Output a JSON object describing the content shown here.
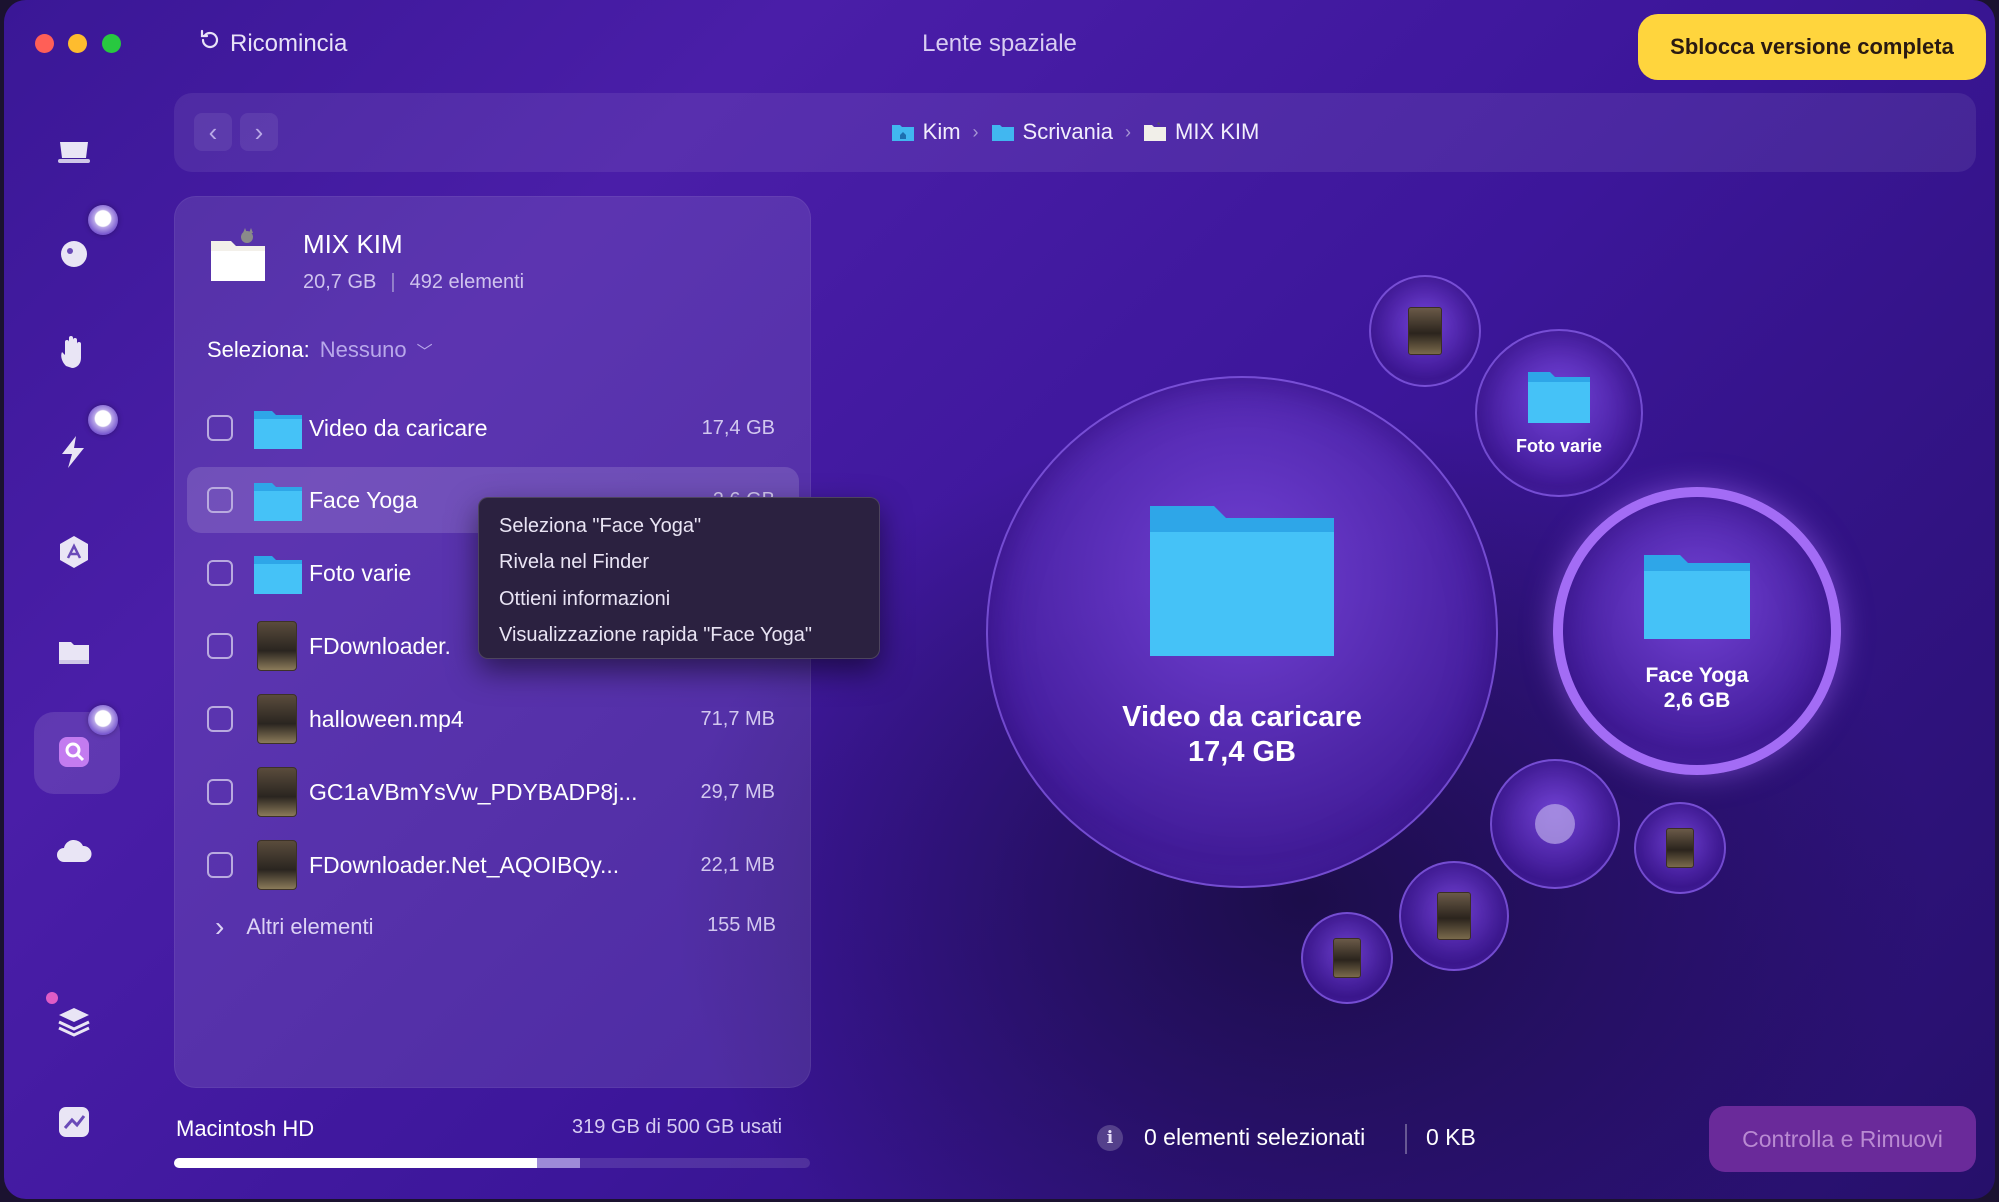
{
  "window": {
    "title": "Lente spaziale",
    "restart_label": "Ricomincia",
    "unlock_label": "Sblocca versione completa"
  },
  "colors": {
    "accent": "#ffd53d",
    "window_bg": "#3a1796",
    "selection_ring": "#a36cf5",
    "action_button": "#6a2a9a",
    "folder": "#39b3ef"
  },
  "breadcrumb": [
    {
      "label": "Kim",
      "icon": "home-folder-icon"
    },
    {
      "label": "Scrivania",
      "icon": "folder-icon"
    },
    {
      "label": "MIX KIM",
      "icon": "folder-icon"
    }
  ],
  "sidebar": [
    {
      "icon": "smart-scan-icon"
    },
    {
      "icon": "cleanup-icon"
    },
    {
      "icon": "protection-icon"
    },
    {
      "icon": "speed-icon"
    },
    {
      "icon": "applications-icon"
    },
    {
      "icon": "my-clutter-icon"
    },
    {
      "icon": "space-lens-icon"
    },
    {
      "icon": "cloud-icon"
    },
    {
      "icon": "shelf-icon"
    },
    {
      "icon": "monitor-icon"
    }
  ],
  "panel": {
    "title": "MIX KIM",
    "size": "20,7 GB",
    "count": "492 elementi",
    "select_label": "Seleziona:",
    "select_value": "Nessuno",
    "items": [
      {
        "name": "Video da caricare",
        "size": "17,4 GB",
        "type": "folder"
      },
      {
        "name": "Face Yoga",
        "size": "2,6 GB",
        "type": "folder"
      },
      {
        "name": "Foto varie",
        "size": "",
        "type": "folder"
      },
      {
        "name": "FDownloader.",
        "size": "",
        "type": "video"
      },
      {
        "name": "halloween.mp4",
        "size": "71,7 MB",
        "type": "video"
      },
      {
        "name": "GC1aVBmYsVw_PDYBADP8j...",
        "size": "29,7 MB",
        "type": "video"
      },
      {
        "name": "FDownloader.Net_AQOIBQy...",
        "size": "22,1 MB",
        "type": "video"
      }
    ],
    "more_label": "Altri elementi",
    "more_size": "155 MB"
  },
  "context_menu": [
    "Seleziona \"Face Yoga\"",
    "Rivela nel Finder",
    "Ottieni informazioni",
    "Visualizzazione rapida \"Face Yoga\""
  ],
  "disk": {
    "name": "Macintosh HD",
    "usage": "319 GB di 500 GB usati",
    "used_fraction": 0.638
  },
  "bubbles": {
    "main": {
      "name": "Video da caricare",
      "size": "17,4 GB"
    },
    "selected": {
      "name": "Face Yoga",
      "size": "2,6 GB"
    },
    "foto": {
      "name": "Foto varie"
    }
  },
  "footer": {
    "selected_count": "0 elementi selezionati",
    "selected_size": "0 KB",
    "action_label": "Controlla e Rimuovi"
  }
}
